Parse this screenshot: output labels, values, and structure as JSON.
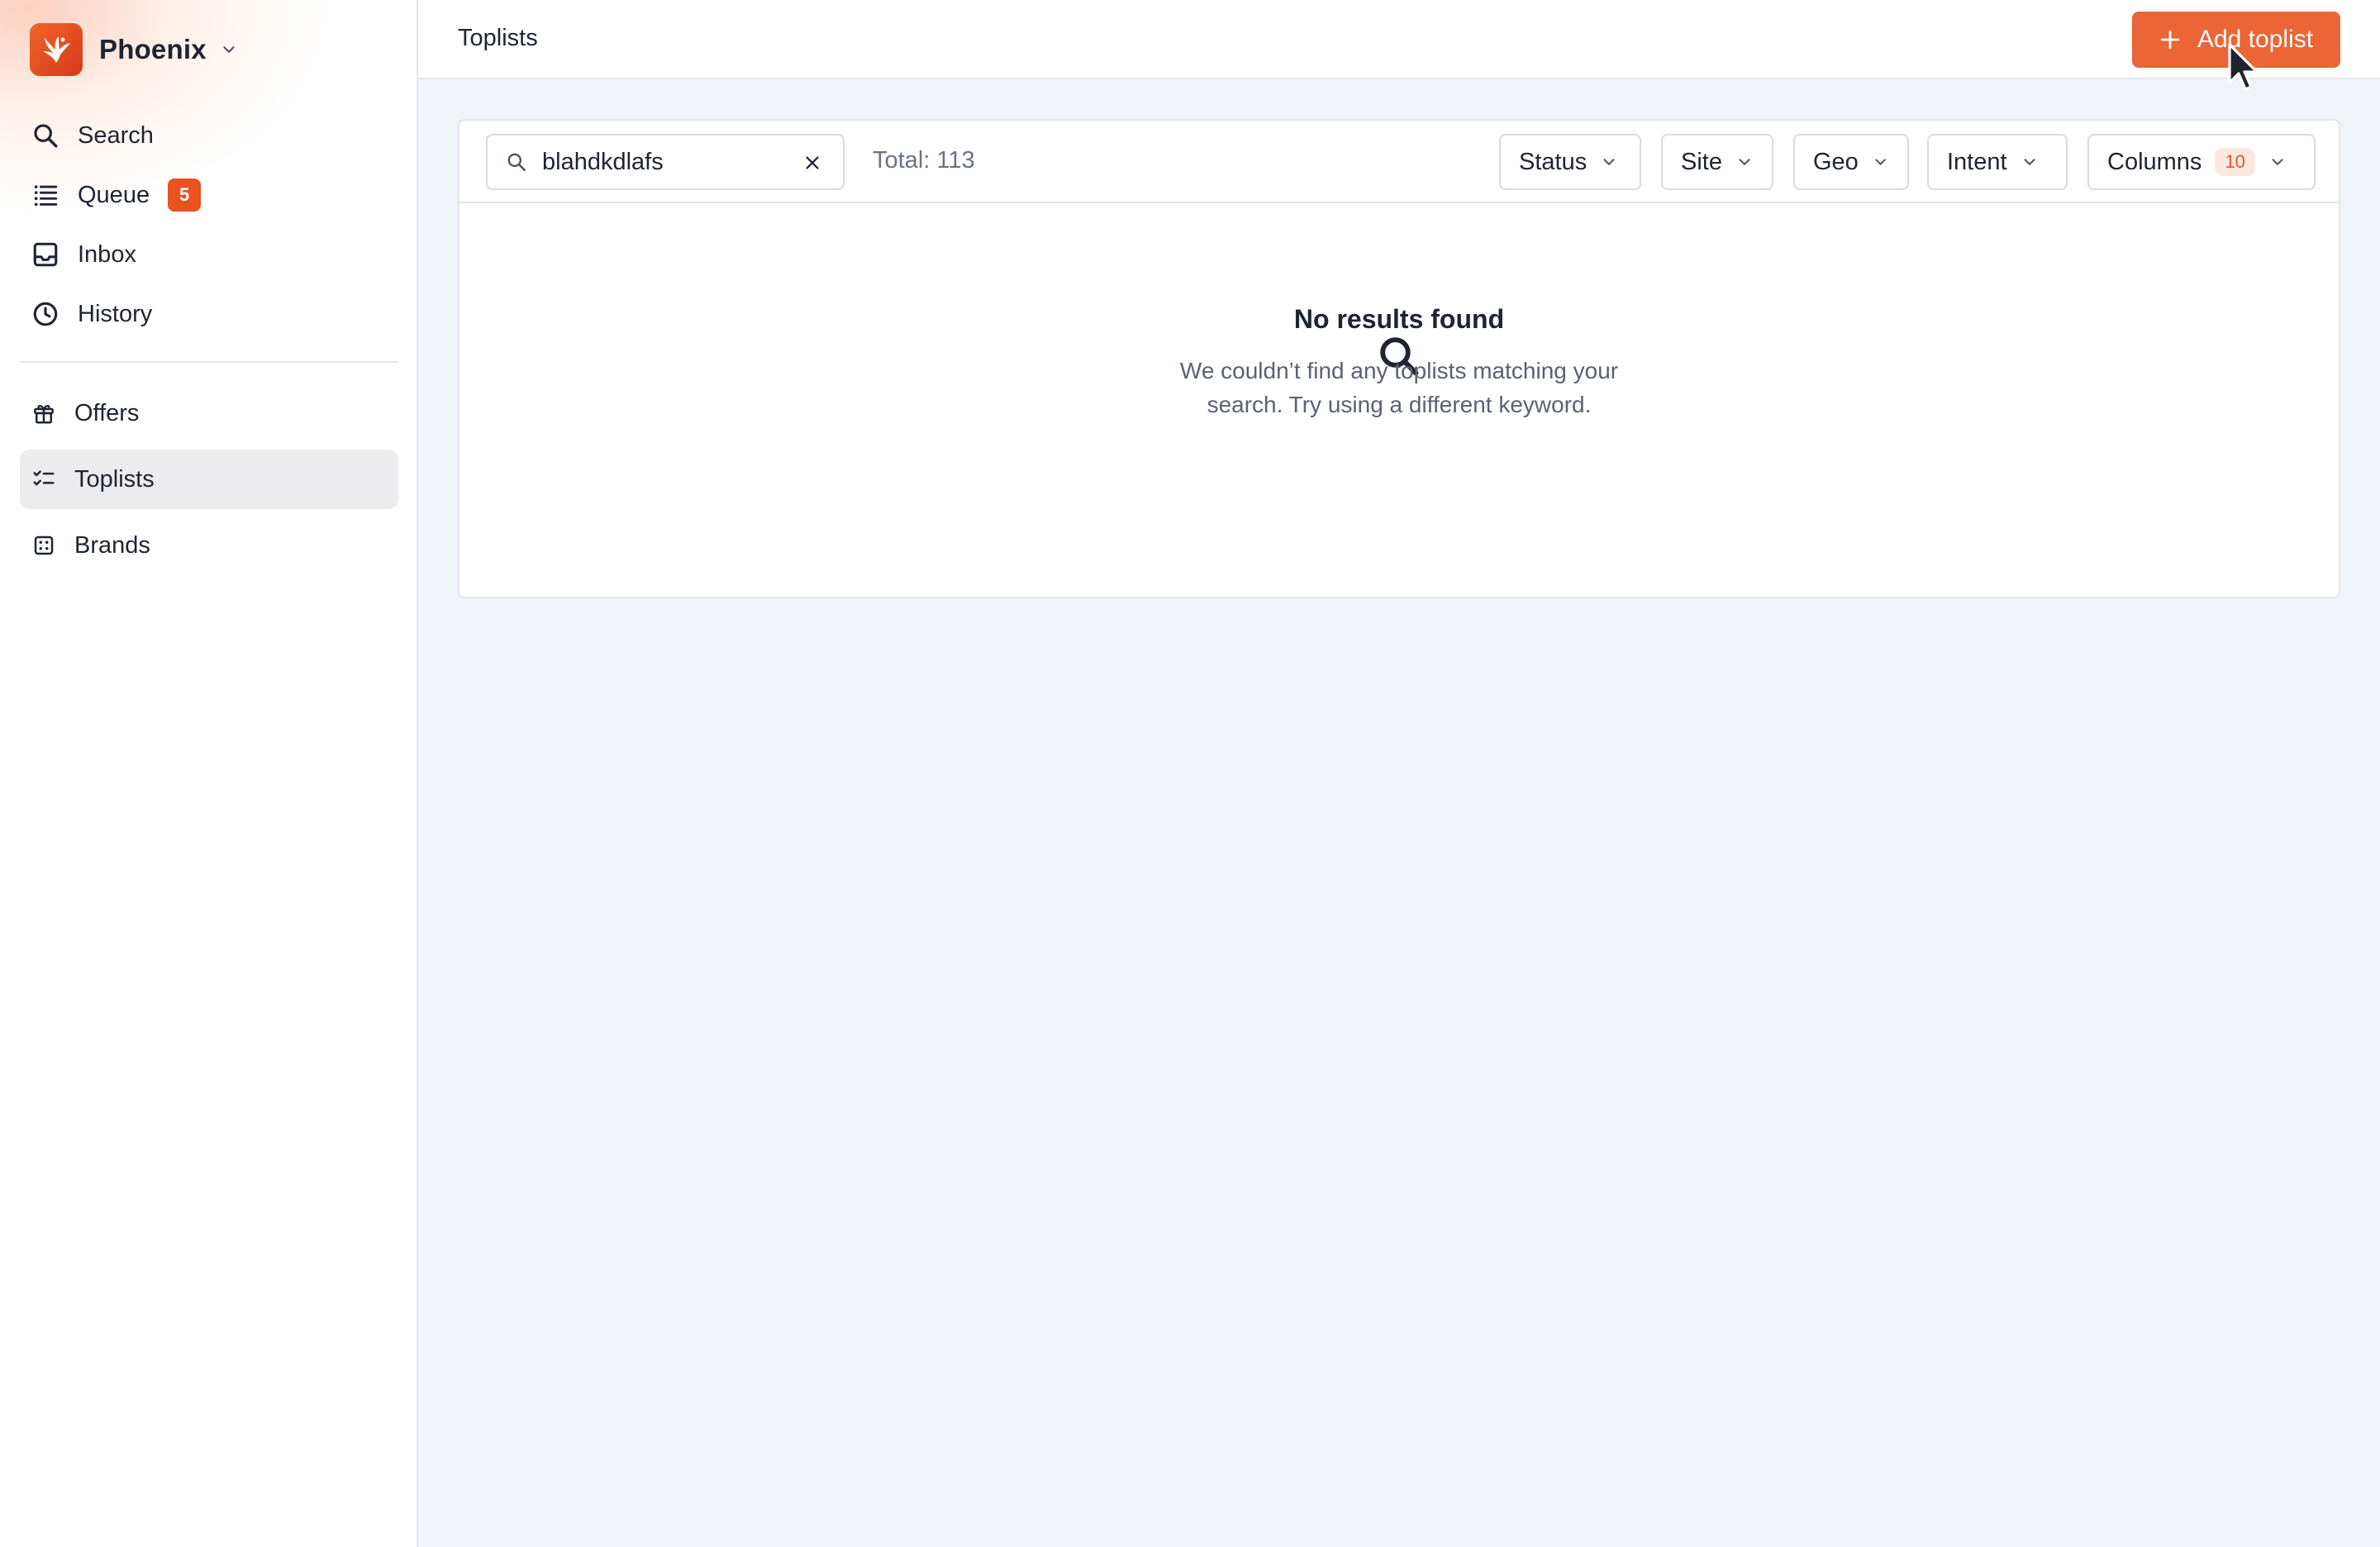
{
  "sidebar": {
    "brand": {
      "name": "Phoenix",
      "logo_color": "#e8531f"
    },
    "nav_primary": [
      {
        "label": "Search",
        "icon": "search-icon"
      },
      {
        "label": "Queue",
        "icon": "list-icon",
        "badge": "5"
      },
      {
        "label": "Inbox",
        "icon": "inbox-icon"
      },
      {
        "label": "History",
        "icon": "clock-icon"
      }
    ],
    "nav_secondary": [
      {
        "label": "Offers",
        "icon": "gift-icon"
      },
      {
        "label": "Toplists",
        "icon": "checklist-icon",
        "active": true
      },
      {
        "label": "Brands",
        "icon": "dice-icon"
      }
    ]
  },
  "header": {
    "title": "Toplists",
    "add_button_label": "Add toplist",
    "accent_color": "#eb6537"
  },
  "toolbar": {
    "search_value": "blahdkdlafs",
    "total_label": "Total: 113",
    "filters": [
      {
        "label": "Status"
      },
      {
        "label": "Site"
      },
      {
        "label": "Geo"
      },
      {
        "label": "Intent"
      }
    ],
    "columns": {
      "label": "Columns",
      "count": "10"
    }
  },
  "empty_state": {
    "title": "No results found",
    "description_line1": "We couldn’t find any toplists matching your",
    "description_line2": "search. Try using a different keyword."
  }
}
